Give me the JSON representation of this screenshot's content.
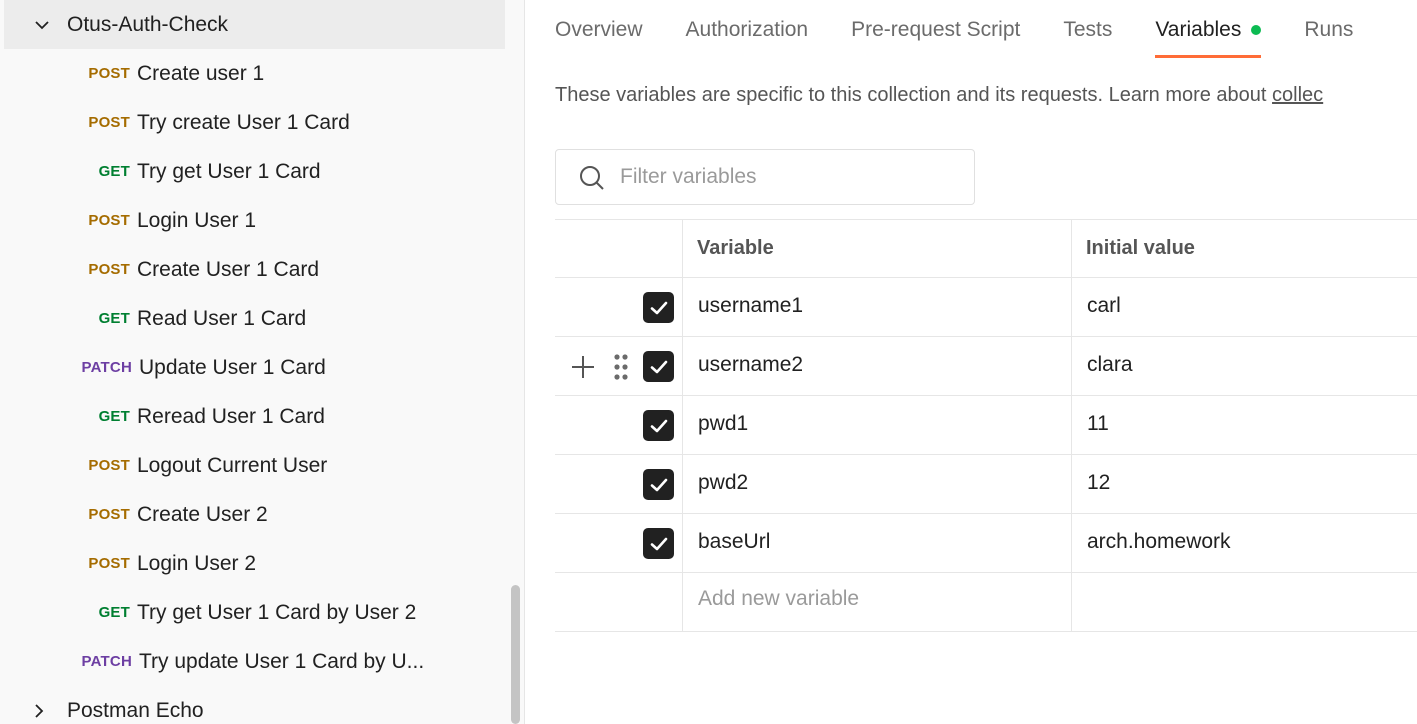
{
  "sidebar": {
    "folder_open": "Otus-Auth-Check",
    "requests": [
      {
        "method": "POST",
        "name": "Create user 1"
      },
      {
        "method": "POST",
        "name": "Try create User 1 Card"
      },
      {
        "method": "GET",
        "name": "Try get User 1 Card"
      },
      {
        "method": "POST",
        "name": "Login User 1"
      },
      {
        "method": "POST",
        "name": "Create User 1 Card"
      },
      {
        "method": "GET",
        "name": "Read User 1 Card"
      },
      {
        "method": "PATCH",
        "name": "Update User 1 Card"
      },
      {
        "method": "GET",
        "name": "Reread User 1 Card"
      },
      {
        "method": "POST",
        "name": "Logout Current User"
      },
      {
        "method": "POST",
        "name": "Create User 2"
      },
      {
        "method": "POST",
        "name": "Login User 2"
      },
      {
        "method": "GET",
        "name": "Try get User 1 Card by User 2"
      },
      {
        "method": "PATCH",
        "name": "Try update User 1 Card by U..."
      }
    ],
    "folder_closed": "Postman Echo"
  },
  "tabs": [
    "Overview",
    "Authorization",
    "Pre-request Script",
    "Tests",
    "Variables",
    "Runs"
  ],
  "active_tab": "Variables",
  "description": {
    "text": "These variables are specific to this collection and its requests. Learn more about ",
    "link": "collec"
  },
  "filter": {
    "placeholder": "Filter variables"
  },
  "table": {
    "headers": {
      "variable": "Variable",
      "initial": "Initial value"
    },
    "rows": [
      {
        "variable": "username1",
        "initial": "carl",
        "enabled": true
      },
      {
        "variable": "username2",
        "initial": "clara",
        "enabled": true
      },
      {
        "variable": "pwd1",
        "initial": "11",
        "enabled": true
      },
      {
        "variable": "pwd2",
        "initial": "12",
        "enabled": true
      },
      {
        "variable": "baseUrl",
        "initial": "arch.homework",
        "enabled": true
      }
    ],
    "add_placeholder": "Add new variable"
  },
  "colors": {
    "post": "#a56c00",
    "get": "#007f31",
    "patch": "#6d3fa3",
    "accent": "#ff6c37",
    "dot": "#0cbb52"
  }
}
